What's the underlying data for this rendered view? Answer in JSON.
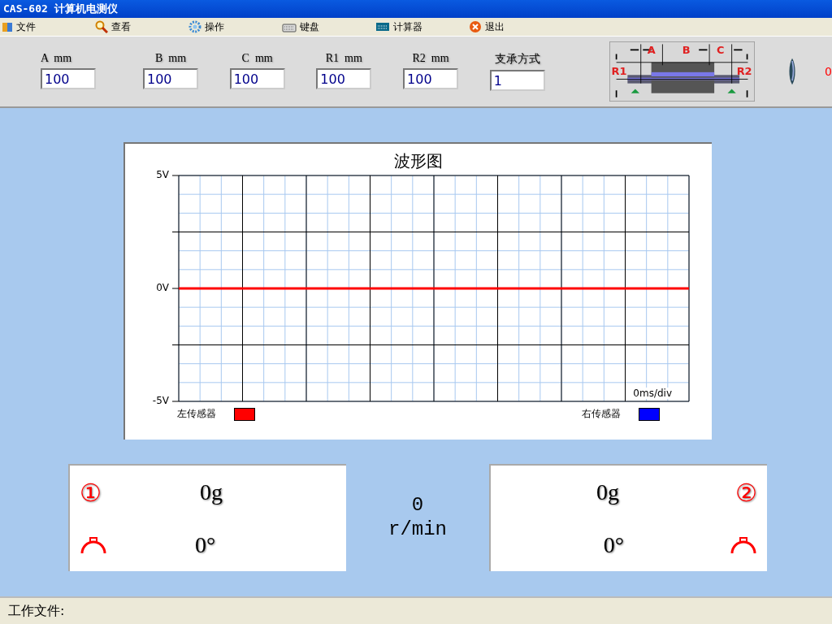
{
  "window": {
    "title": "CAS-602 计算机电测仪"
  },
  "menu": [
    {
      "label": "文件"
    },
    {
      "label": "查看"
    },
    {
      "label": "操作"
    },
    {
      "label": "键盘"
    },
    {
      "label": "计算器"
    },
    {
      "label": "退出"
    }
  ],
  "params": [
    {
      "label": "A  mm",
      "value": "100"
    },
    {
      "label": "B  mm",
      "value": "100"
    },
    {
      "label": "C  mm",
      "value": "100"
    },
    {
      "label": "R1  mm",
      "value": "100"
    },
    {
      "label": "R2  mm",
      "value": "100"
    },
    {
      "label": "支承方式",
      "value": "1"
    }
  ],
  "diagram": {
    "labels": [
      "A",
      "B",
      "C",
      "R1",
      "R2"
    ]
  },
  "counter": "0",
  "chart": {
    "scale": "0ms/div",
    "legend": [
      {
        "name": "左传感器",
        "color": "#ff0000"
      },
      {
        "name": "右传感器",
        "color": "#0000ff"
      }
    ],
    "chart_data": {
      "type": "line",
      "title": "波形图",
      "grid": true,
      "ylim": [
        -5,
        5
      ],
      "yticks": [
        {
          "value": 5,
          "label": "5V"
        },
        {
          "value": 0,
          "label": "0V"
        },
        {
          "value": -5,
          "label": "-5V"
        }
      ],
      "series": [
        {
          "color": "#ff0000",
          "values": [
            0,
            0,
            0,
            0,
            0,
            0,
            0,
            0,
            0
          ]
        }
      ]
    }
  },
  "readouts": [
    {
      "badge": "①",
      "weight": "0g",
      "angle": "0°"
    },
    {
      "badge": "②",
      "weight": "0g",
      "angle": "0°"
    }
  ],
  "speed": {
    "value": "0",
    "unit": "r/min"
  },
  "status_bar": {
    "label": "工作文件:"
  }
}
